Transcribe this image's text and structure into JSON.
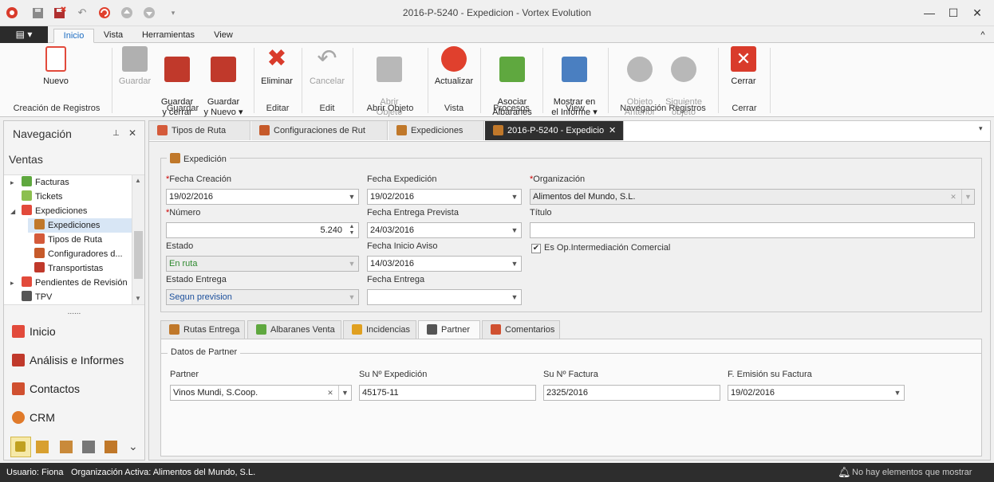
{
  "window": {
    "title": "2016-P-5240 - Expedicion - Vortex Evolution",
    "minimize_label": "—",
    "maximize_label": "☐",
    "close_label": "✕"
  },
  "quick_access": [
    "app-logo-icon",
    "save-icon",
    "save-close-icon",
    "undo-icon",
    "refresh-icon",
    "up-icon",
    "down-icon",
    "customize-icon"
  ],
  "menu": {
    "app_button": "▤ ▾",
    "tabs": [
      "Inicio",
      "Vista",
      "Herramientas",
      "View"
    ],
    "collapse_label": "^"
  },
  "ribbon": {
    "buttons": [
      {
        "label": "Nuevo",
        "enabled": true,
        "color": "#e24a3b"
      },
      {
        "label": "Guardar",
        "enabled": false,
        "color": "#9a9a9a"
      },
      {
        "label": "Guardar\ny cerrar",
        "enabled": true,
        "color": "#c0392b"
      },
      {
        "label": "Guardar\ny Nuevo ▾",
        "enabled": true,
        "color": "#c0392b"
      },
      {
        "label": "Eliminar",
        "enabled": true,
        "color": "#d93b2b"
      },
      {
        "label": "Cancelar",
        "enabled": false,
        "color": "#9a9a9a"
      },
      {
        "label": "Abrir\nObjeto",
        "enabled": false,
        "color": "#9a9a9a"
      },
      {
        "label": "Actualizar",
        "enabled": true,
        "color": "#e0402d"
      },
      {
        "label": "Asociar\nAlbaranes",
        "enabled": true,
        "color": "#5fa83f"
      },
      {
        "label": "Mostrar en\nel Informe ▾",
        "enabled": true,
        "color": "#4a7fc1"
      },
      {
        "label": "Objeto\nAnterior",
        "enabled": false,
        "color": "#a8a8a8"
      },
      {
        "label": "Siguiente\nobjeto",
        "enabled": false,
        "color": "#a8a8a8"
      },
      {
        "label": "Cerrar",
        "enabled": true,
        "color": "#d93b2b"
      }
    ],
    "groups": [
      "Creación de Registros",
      "Guardar",
      "Editar",
      "Edit",
      "Abrir Objeto",
      "Vista",
      "Procesos",
      "View",
      "Navegación Registros",
      "Cerrar"
    ]
  },
  "navigation": {
    "title": "Navegación",
    "pin_label": "⊥",
    "close_label": "✕",
    "section": "Ventas",
    "tree": [
      {
        "label": "Facturas",
        "level": 0,
        "expander": "▸",
        "icon_color": "#5fa83f",
        "selected": false
      },
      {
        "label": "Tickets",
        "level": 0,
        "expander": "",
        "icon_color": "#8cbf4f",
        "selected": false
      },
      {
        "label": "Expediciones",
        "level": 0,
        "expander": "◢",
        "icon_color": "#e24a3b",
        "selected": false
      },
      {
        "label": "Expediciones",
        "level": 1,
        "expander": "",
        "icon_color": "#c0782a",
        "selected": true
      },
      {
        "label": "Tipos de Ruta",
        "level": 1,
        "expander": "",
        "icon_color": "#d45a3a",
        "selected": false
      },
      {
        "label": "Configuradores d...",
        "level": 1,
        "expander": "",
        "icon_color": "#c65a2a",
        "selected": false
      },
      {
        "label": "Transportistas",
        "level": 1,
        "expander": "",
        "icon_color": "#c0392b",
        "selected": false
      },
      {
        "label": "Pendientes de Revisión",
        "level": 0,
        "expander": "▸",
        "icon_color": "#e24a3b",
        "selected": false
      },
      {
        "label": "TPV",
        "level": 0,
        "expander": "",
        "icon_color": "#555555",
        "selected": false
      }
    ],
    "splitter": "......",
    "buttons": [
      {
        "label": "Inicio",
        "icon_color": "#e24a3b"
      },
      {
        "label": "Análisis e Informes",
        "icon_color": "#c0392b"
      },
      {
        "label": "Contactos",
        "icon_color": "#d05030"
      },
      {
        "label": "CRM",
        "icon_color": "#e07a2a"
      }
    ],
    "bottom_icons": [
      "facturas-icon",
      "albaranes-icon",
      "pedidos-icon",
      "tpv-icon",
      "expediciones-icon"
    ],
    "more_label": "⌄"
  },
  "doc_tabs": [
    {
      "label": "Tipos de Ruta",
      "active": false
    },
    {
      "label": "Configuraciones de Rut",
      "active": false
    },
    {
      "label": "Expediciones",
      "active": false
    },
    {
      "label": "2016-P-5240 - Expedicio",
      "active": true
    }
  ],
  "doc_tab_close": "✕",
  "doc_tabs_menu": "▾",
  "form": {
    "legend": "Expedición",
    "fecha_creacion_label": "Fecha Creación",
    "fecha_creacion": "19/02/2016",
    "numero_label": "Número",
    "numero": "5.240",
    "estado_label": "Estado",
    "estado": "En ruta",
    "estado_entrega_label": "Estado Entrega",
    "estado_entrega": "Segun prevision",
    "fecha_expedicion_label": "Fecha Expedición",
    "fecha_expedicion": "19/02/2016",
    "fecha_entrega_prevista_label": "Fecha Entrega Prevista",
    "fecha_entrega_prevista": "24/03/2016",
    "fecha_inicio_aviso_label": "Fecha Inicio Aviso",
    "fecha_inicio_aviso": "14/03/2016",
    "fecha_entrega_label": "Fecha Entrega",
    "fecha_entrega": "",
    "organizacion_label": "Organización",
    "organizacion": "Alimentos del Mundo, S.L.",
    "titulo_label": "Título",
    "titulo": "",
    "intermediacion_label": "Es Op.Intermediación Comercial",
    "intermediacion_checked": true,
    "required_mark": "*"
  },
  "content_tabs": [
    {
      "label": "Rutas Entrega",
      "active": false,
      "icon_color": "#c0782a"
    },
    {
      "label": "Albaranes Venta",
      "active": false,
      "icon_color": "#5fa83f"
    },
    {
      "label": "Incidencias",
      "active": false,
      "icon_color": "#e0a020"
    },
    {
      "label": "Partner",
      "active": true,
      "icon_color": "#555555"
    },
    {
      "label": "Comentarios",
      "active": false,
      "icon_color": "#d05030"
    }
  ],
  "partner": {
    "legend": "Datos de Partner",
    "partner_label": "Partner",
    "partner": "Vinos Mundi, S.Coop.",
    "expedicion_label": "Su Nº Expedición",
    "expedicion": "45175-11",
    "factura_label": "Su Nº Factura",
    "factura": "2325/2016",
    "emision_label": "F. Emisión su Factura",
    "emision": "19/02/2016"
  },
  "status": {
    "usuario": "Usuario: Fiona",
    "organizacion": "Organización Activa: Alimentos del Mundo, S.L.",
    "notifications": "No hay elementos que mostrar"
  }
}
